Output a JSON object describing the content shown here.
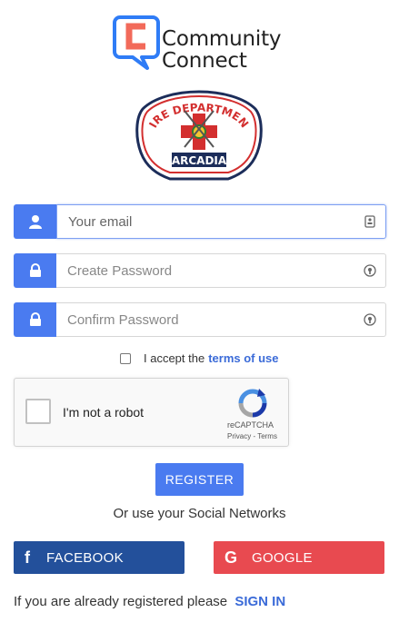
{
  "brand": {
    "line1": "Community",
    "line2": "Connect",
    "badge_top_text": "FIRE DEPARTMENT",
    "badge_bottom_text": "ARCADIA"
  },
  "form": {
    "email": {
      "value": "",
      "placeholder": "Your email",
      "icon": "user-icon",
      "trailing_icon": "contact-card-icon"
    },
    "password": {
      "value": "",
      "placeholder": "Create Password",
      "icon": "lock-icon",
      "trailing_icon": "password-manager-icon"
    },
    "confirm": {
      "value": "",
      "placeholder": "Confirm Password",
      "icon": "lock-icon",
      "trailing_icon": "password-manager-icon"
    },
    "terms": {
      "prefix": "I accept the",
      "link": "terms of use",
      "checked": false
    }
  },
  "captcha": {
    "label": "I'm not a robot",
    "brand": "reCAPTCHA",
    "links": "Privacy - Terms",
    "checked": false
  },
  "actions": {
    "register": "REGISTER",
    "or_text": "Or use your Social Networks",
    "facebook": "FACEBOOK",
    "google": "GOOGLE",
    "signin_prefix": "If you are already registered please",
    "signin_link": "SIGN IN"
  },
  "colors": {
    "accent": "#4a7bf0",
    "link": "#3b6bd8",
    "facebook": "#23509b",
    "google": "#e84a50",
    "logo_red": "#f26a5a"
  }
}
